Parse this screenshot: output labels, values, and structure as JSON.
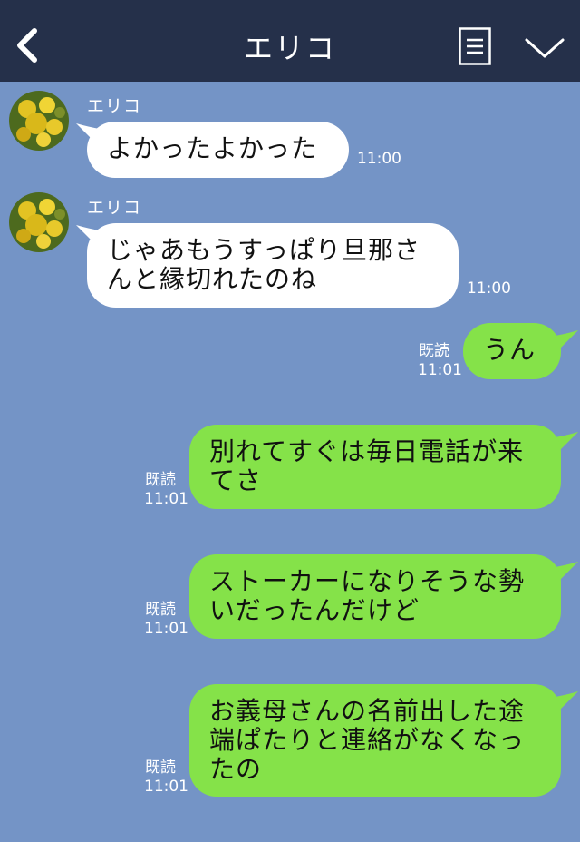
{
  "header": {
    "title": "エリコ",
    "back_icon": "chevron-left-icon",
    "menu_icon": "menu-icon",
    "collapse_icon": "chevron-down-icon"
  },
  "messages": [
    {
      "side": "in",
      "sender": "エリコ",
      "text": "よかったよかった",
      "time": "11:00"
    },
    {
      "side": "in",
      "sender": "エリコ",
      "text": "じゃあもうすっぱり旦那さんと縁切れたのね",
      "time": "11:00"
    },
    {
      "side": "out",
      "read": "既読",
      "text": "うん",
      "time": "11:01"
    },
    {
      "side": "out",
      "read": "既読",
      "text": "別れてすぐは毎日電話が来てさ",
      "time": "11:01"
    },
    {
      "side": "out",
      "read": "既読",
      "text": "ストーカーになりそうな勢いだったんだけど",
      "time": "11:01"
    },
    {
      "side": "out",
      "read": "既読",
      "text": "お義母さんの名前出した途端ぱたりと連絡がなくなったの",
      "time": "11:01"
    }
  ],
  "colors": {
    "background": "#7494c6",
    "header": "#25304a",
    "incoming_bubble": "#ffffff",
    "outgoing_bubble": "#85e249"
  }
}
